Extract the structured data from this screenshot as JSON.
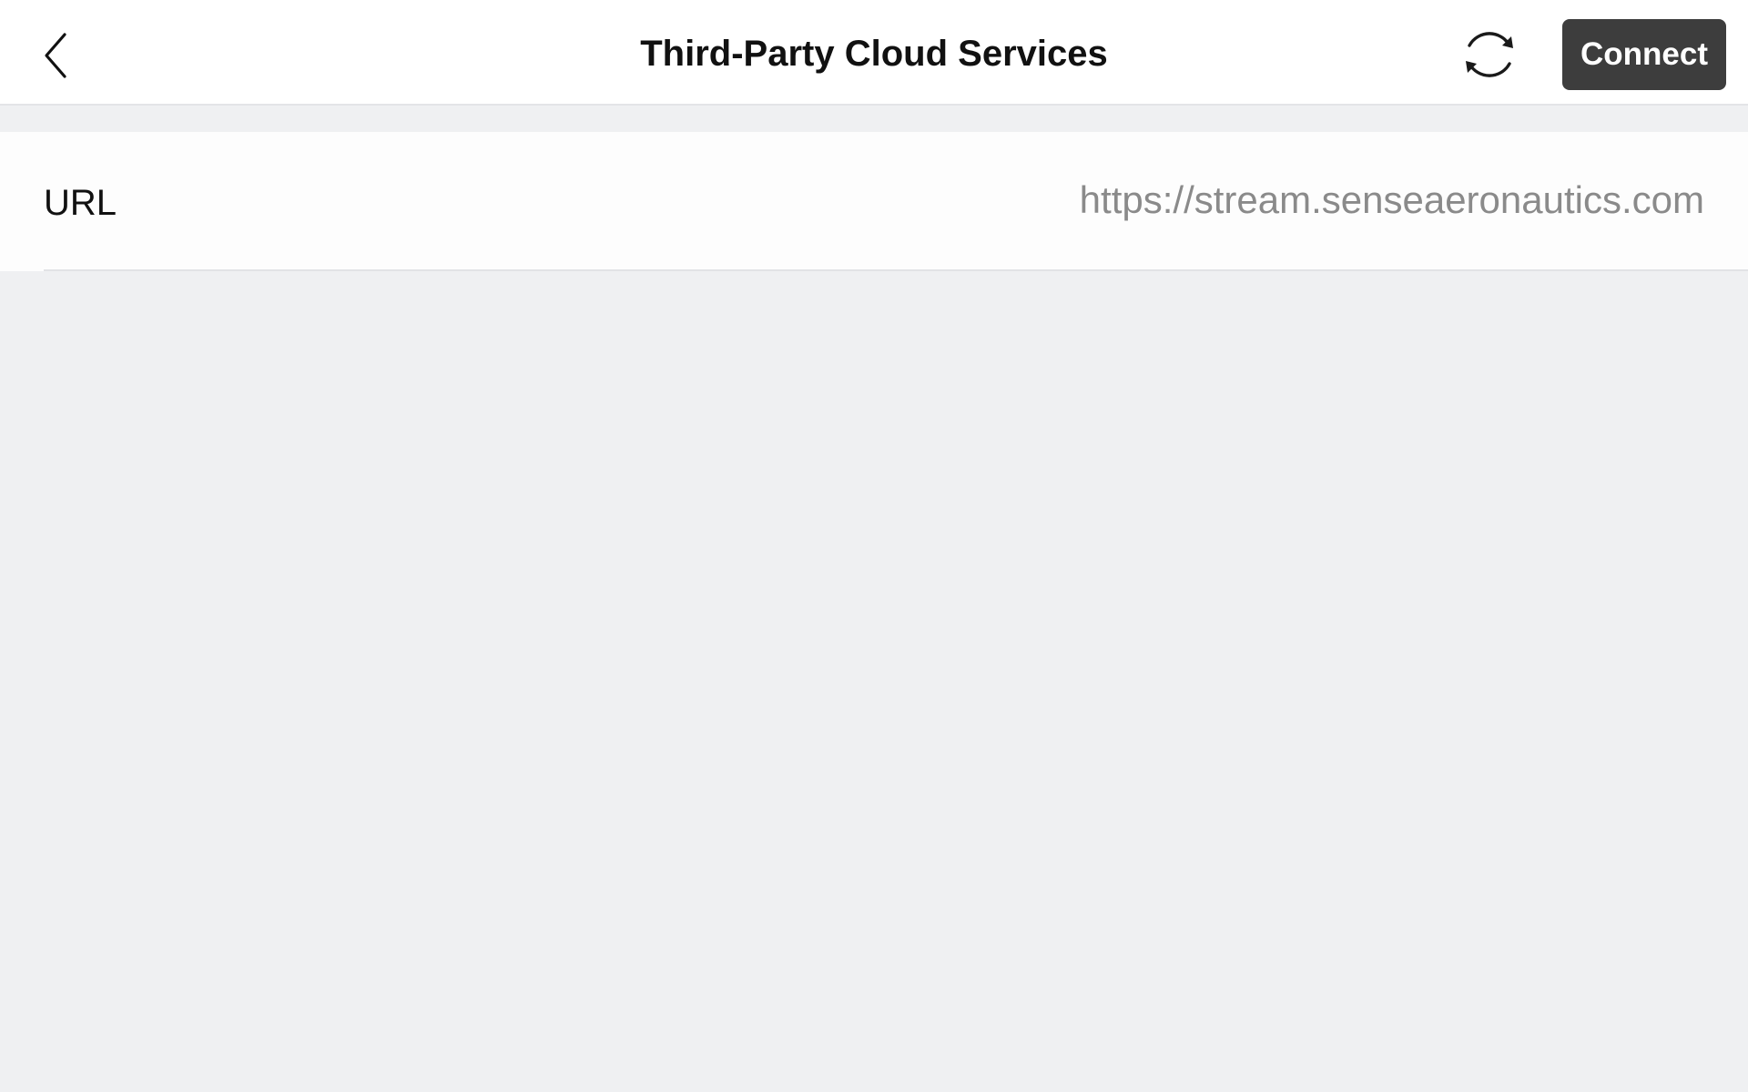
{
  "header": {
    "title": "Third-Party Cloud Services",
    "back_icon": "chevron-left-icon",
    "refresh_icon": "refresh-icon",
    "connect_label": "Connect"
  },
  "settings": {
    "url_row": {
      "label": "URL",
      "value": "https://stream.senseaeronautics.com"
    }
  },
  "colors": {
    "background": "#eff0f2",
    "header_background": "#ffffff",
    "connect_button": "#3d3d3d",
    "value_text": "#8a8a8a"
  }
}
